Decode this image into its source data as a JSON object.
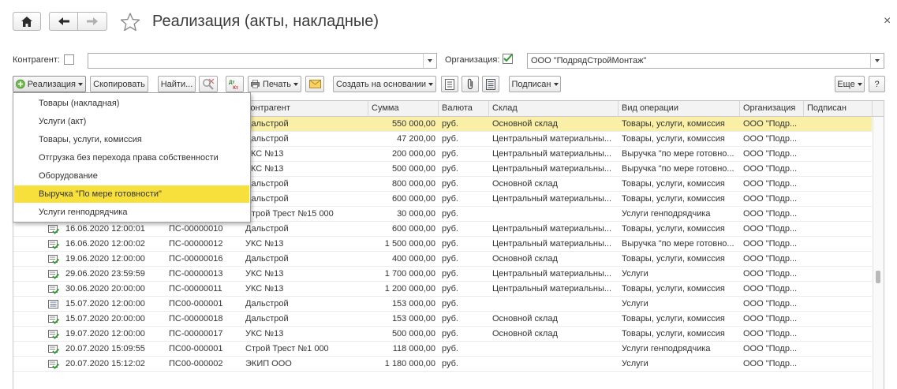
{
  "window": {
    "title": "Реализация (акты, накладные)",
    "close_glyph": "×"
  },
  "nav": {
    "home_icon": "home-icon",
    "back_icon": "arrow-left-icon",
    "forward_icon": "arrow-right-icon",
    "favorite_icon": "star-icon"
  },
  "filters": {
    "counterparty_label": "Контрагент:",
    "counterparty_checked": false,
    "counterparty_value": "",
    "organization_label": "Организация:",
    "organization_checked": true,
    "organization_value": "ООО \"ПодрядСтройМонтаж\""
  },
  "toolbar": {
    "create_label": "Реализация",
    "copy_label": "Скопировать",
    "find_label": "Найти...",
    "print_label": "Печать",
    "create_based_label": "Создать на основании",
    "signed_label": "Подписан",
    "more_label": "Еще",
    "help_label": "?"
  },
  "menu": {
    "items": [
      {
        "label": "Товары (накладная)"
      },
      {
        "label": "Услуги (акт)"
      },
      {
        "label": "Товары, услуги, комиссия"
      },
      {
        "label": "Отгрузка без перехода права собственности"
      },
      {
        "label": "Оборудование"
      },
      {
        "label": "Выручка \"По мере готовности\""
      },
      {
        "label": "Услуги генподрядчика"
      }
    ],
    "highlighted_index": 5,
    "highlight_color": "#f7e03c"
  },
  "table": {
    "columns": {
      "counterparty": "Контрагент",
      "sum": "Сумма",
      "currency": "Валюта",
      "warehouse": "Склад",
      "operation": "Вид операции",
      "organization": "Организация",
      "signed": "Подписан"
    },
    "rows": [
      {
        "date": "",
        "number": "",
        "counterparty": "Дальстрой",
        "sum": "550 000,00",
        "currency": "руб.",
        "warehouse": "Основной склад",
        "operation": "Товары, услуги, комиссия",
        "organization": "ООО \"Подр...",
        "icon": "doc-posted-icon",
        "selected": true
      },
      {
        "date": "",
        "number": "",
        "counterparty": "Дальстрой",
        "sum": "47 200,00",
        "currency": "руб.",
        "warehouse": "Центральный материальны...",
        "operation": "Товары, услуги, комиссия",
        "organization": "ООО \"Подр...",
        "icon": "doc-posted-icon",
        "selected": false
      },
      {
        "date": "",
        "number": "",
        "counterparty": "УКС №13",
        "sum": "200 000,00",
        "currency": "руб.",
        "warehouse": "Центральный материальны...",
        "operation": "Выручка \"по мере готовно...",
        "organization": "ООО \"Подр...",
        "icon": "doc-posted-icon",
        "selected": false
      },
      {
        "date": "",
        "number": "",
        "counterparty": "УКС №13",
        "sum": "500 000,00",
        "currency": "руб.",
        "warehouse": "Центральный материальны...",
        "operation": "Выручка \"по мере готовно...",
        "organization": "ООО \"Подр...",
        "icon": "doc-posted-icon",
        "selected": false
      },
      {
        "date": "",
        "number": "",
        "counterparty": "Дальстрой",
        "sum": "800 000,00",
        "currency": "руб.",
        "warehouse": "Основной склад",
        "operation": "Товары, услуги, комиссия",
        "organization": "ООО \"Подр...",
        "icon": "doc-posted-icon",
        "selected": false
      },
      {
        "date": "",
        "number": "",
        "counterparty": "Дальстрой",
        "sum": "600 000,00",
        "currency": "руб.",
        "warehouse": "Центральный материальны...",
        "operation": "Товары, услуги, комиссия",
        "organization": "ООО \"Подр...",
        "icon": "doc-posted-icon",
        "selected": false
      },
      {
        "date": "",
        "number": "",
        "counterparty": "Строй Трест №15 000",
        "sum": "30 000,00",
        "currency": "руб.",
        "warehouse": "",
        "operation": "Услуги генподрядчика",
        "organization": "ООО \"Подр...",
        "icon": "doc-posted-icon",
        "selected": false
      },
      {
        "date": "16.06.2020 12:00:01",
        "number": "ПС-00000010",
        "counterparty": "Дальстрой",
        "sum": "600 000,00",
        "currency": "руб.",
        "warehouse": "Центральный материальны...",
        "operation": "Товары, услуги, комиссия",
        "organization": "ООО \"Подр...",
        "icon": "doc-posted-icon",
        "selected": false
      },
      {
        "date": "16.06.2020 12:00:02",
        "number": "ПС-00000012",
        "counterparty": "УКС №13",
        "sum": "1 500 000,00",
        "currency": "руб.",
        "warehouse": "Центральный материальны...",
        "operation": "Выручка \"по мере готовно...",
        "organization": "ООО \"Подр...",
        "icon": "doc-posted-icon",
        "selected": false
      },
      {
        "date": "19.06.2020 12:00:00",
        "number": "ПС-00000016",
        "counterparty": "Дальстрой",
        "sum": "400 000,00",
        "currency": "руб.",
        "warehouse": "Основной склад",
        "operation": "Товары, услуги, комиссия",
        "organization": "ООО \"Подр...",
        "icon": "doc-posted-icon",
        "selected": false
      },
      {
        "date": "29.06.2020 23:59:59",
        "number": "ПС-00000013",
        "counterparty": "УКС №13",
        "sum": "1 700 000,00",
        "currency": "руб.",
        "warehouse": "Центральный материальны...",
        "operation": "Услуги",
        "organization": "ООО \"Подр...",
        "icon": "doc-posted-icon",
        "selected": false
      },
      {
        "date": "30.06.2020 20:00:00",
        "number": "ПС-00000011",
        "counterparty": "УКС №13",
        "sum": "1 200 000,00",
        "currency": "руб.",
        "warehouse": "Центральный материальны...",
        "operation": "Товары, услуги, комиссия",
        "organization": "ООО \"Подр...",
        "icon": "doc-posted-icon",
        "selected": false
      },
      {
        "date": "15.07.2020 12:00:00",
        "number": "ПС00-000001",
        "counterparty": "Дальстрой",
        "sum": "153 000,00",
        "currency": "руб.",
        "warehouse": "",
        "operation": "Услуги",
        "organization": "ООО \"Подр...",
        "icon": "doc-draft-icon",
        "selected": false
      },
      {
        "date": "15.07.2020 20:00:00",
        "number": "ПС-00000018",
        "counterparty": "Дальстрой",
        "sum": "153 000,00",
        "currency": "руб.",
        "warehouse": "Основной склад",
        "operation": "Товары, услуги, комиссия",
        "organization": "ООО \"Подр...",
        "icon": "doc-posted-icon",
        "selected": false
      },
      {
        "date": "19.07.2020 12:00:00",
        "number": "ПС-00000017",
        "counterparty": "УКС №13",
        "sum": "500 000,00",
        "currency": "руб.",
        "warehouse": "Основной склад",
        "operation": "Товары, услуги, комиссия",
        "organization": "ООО \"Подр...",
        "icon": "doc-posted-icon",
        "selected": false
      },
      {
        "date": "20.07.2020 15:09:55",
        "number": "ПС00-000001",
        "counterparty": "Строй Трест №1 000",
        "sum": "118 000,00",
        "currency": "руб.",
        "warehouse": "",
        "operation": "Услуги генподрядчика",
        "organization": "ООО \"Подр...",
        "icon": "doc-posted-icon",
        "selected": false
      },
      {
        "date": "20.07.2020 15:12:02",
        "number": "ПС00-000002",
        "counterparty": "ЭКИП ООО",
        "sum": "1 180 000,00",
        "currency": "руб.",
        "warehouse": "",
        "operation": "Услуги",
        "organization": "ООО \"Подр...",
        "icon": "doc-posted-icon",
        "selected": false
      }
    ]
  }
}
